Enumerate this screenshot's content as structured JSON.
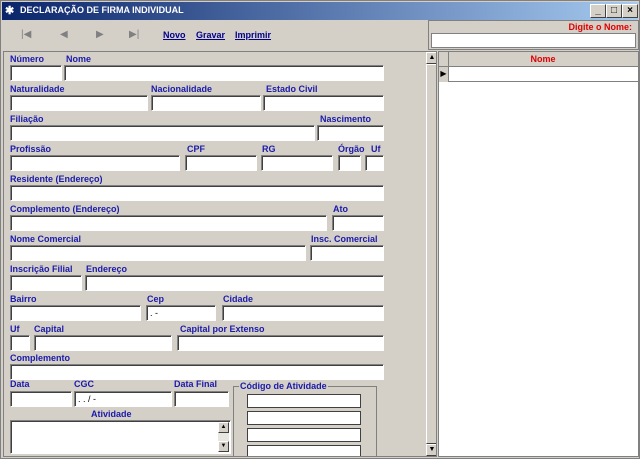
{
  "window": {
    "title": "DECLARAÇÃO DE FIRMA INDIVIDUAL",
    "minimize": "_",
    "maximize": "□",
    "close": "×"
  },
  "nav": {
    "first": "|◀",
    "prev": "◀",
    "next": "▶",
    "last": "▶|",
    "novo": "Novo",
    "gravar": "Gravar",
    "imprimir": "Imprimir"
  },
  "search": {
    "label": "Digite o Nome:",
    "value": ""
  },
  "form": {
    "numero": "Número",
    "nome": "Nome",
    "naturalidade": "Naturalidade",
    "nacionalidade": "Nacionalidade",
    "estado_civil": "Estado Civil",
    "filiacao": "Filiação",
    "nascimento": "Nascimento",
    "profissao": "Profissão",
    "cpf": "CPF",
    "rg": "RG",
    "orgao": "Órgão",
    "uf": "Uf",
    "residente": "Residente (Endereço)",
    "complemento_endereco": "Complemento (Endereço)",
    "ato": "Ato",
    "nome_comercial": "Nome Comercial",
    "insc_comercial": "Insc. Comercial",
    "inscricao_filial": "Inscrição Filial",
    "endereco": "Endereço",
    "bairro": "Bairro",
    "cep": "Cep",
    "cep_value": "  .  -",
    "cidade": "Cidade",
    "uf2": "Uf",
    "capital": "Capital",
    "capital_extenso": "Capital por Extenso",
    "complemento": "Complemento",
    "data": "Data",
    "cgc": "CGC",
    "cgc_value": "  .  .  /  -",
    "data_final": "Data Final",
    "atividade": "Atividade",
    "codigo_atividade": "Código de Atividade"
  },
  "grid": {
    "column": "Nome",
    "indicator": "▶"
  },
  "scroll": {
    "up": "▲",
    "down": "▼"
  }
}
